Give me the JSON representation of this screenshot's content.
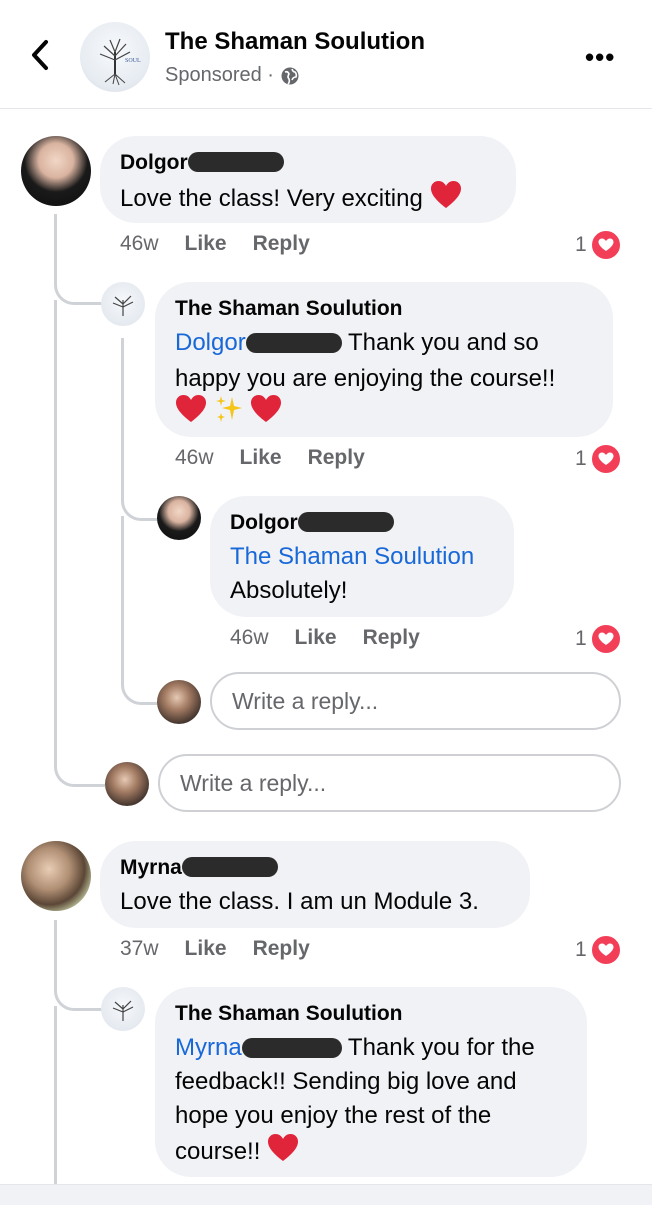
{
  "header": {
    "page_name": "The Shaman Soulution",
    "sponsored": "Sponsored ·"
  },
  "comments": [
    {
      "author": "Dolgor",
      "text": "Love the class! Very exciting",
      "time": "46w",
      "like": "Like",
      "reply": "Reply",
      "reactions": "1",
      "replies": [
        {
          "author": "The Shaman Soulution",
          "mention": "Dolgor",
          "line1": "Thank you and so",
          "line2": "happy you are enjoying the course!!",
          "time": "46w",
          "like": "Like",
          "reply": "Reply",
          "reactions": "1"
        },
        {
          "author": "Dolgor",
          "mention": "The Shaman Soulution",
          "line1": "Absolutely!",
          "time": "46w",
          "like": "Like",
          "reply": "Reply",
          "reactions": "1"
        }
      ],
      "reply_placeholder_nested": "Write a reply...",
      "reply_placeholder": "Write a reply..."
    },
    {
      "author": "Myrna",
      "text": "Love the class. I am un Module 3.",
      "time": "37w",
      "like": "Like",
      "reply": "Reply",
      "reactions": "1",
      "replies": [
        {
          "author": "The Shaman Soulution",
          "mention": "Myrna",
          "line1": "Thank you for the",
          "line2": "feedback!! Sending big love and",
          "line3": "hope you enjoy the rest of the",
          "line4": "course!!"
        }
      ]
    }
  ],
  "colors": {
    "link": "#1868d8",
    "love": "#f33e58",
    "bubble": "#f0f2f5"
  },
  "icons": [
    "back-chevron-icon",
    "globe-icon",
    "more-icon",
    "heart-emoji",
    "sparkles-emoji",
    "love-reaction-icon"
  ]
}
